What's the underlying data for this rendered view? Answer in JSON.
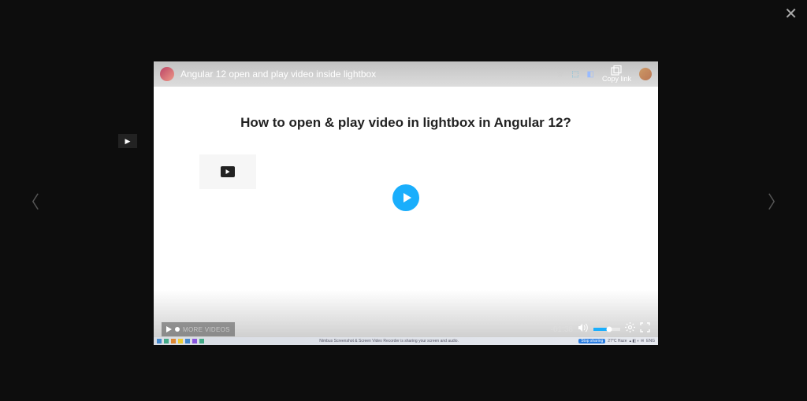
{
  "lightbox": {
    "close": "✕",
    "prev": "〈",
    "next": "〉"
  },
  "player": {
    "title": "Angular 12 open and play video inside lightbox",
    "copylink_label": "Copy link",
    "headline": "How to open & play video in lightbox in Angular 12?",
    "controls": {
      "more_label": "MORE VIDEOS",
      "time": "-01:38"
    },
    "taskbar": {
      "center_text": "Nimbus Screenshot & Screen Video Recorder is sharing your screen and audio.",
      "share": "Stop sharing",
      "weather": "27°C Haze",
      "lang": "ENG"
    }
  }
}
